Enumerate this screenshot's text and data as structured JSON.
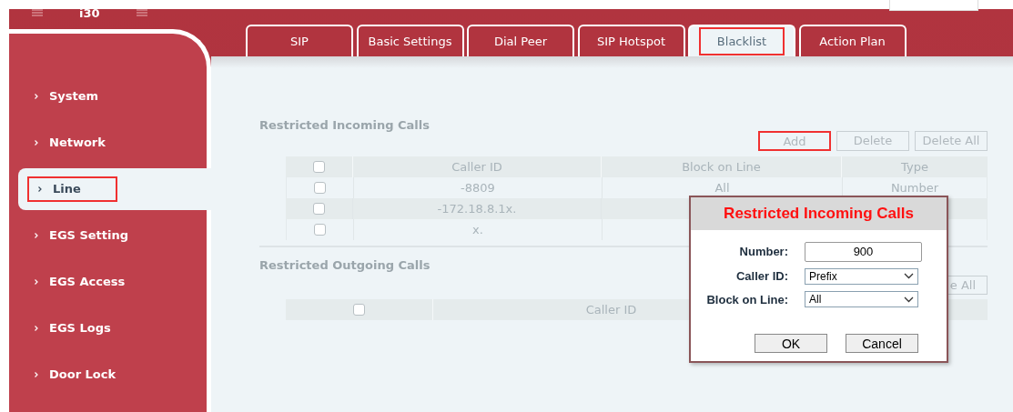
{
  "header": {
    "title": "i30"
  },
  "sidebar": {
    "items": [
      {
        "label": "System",
        "selected": false,
        "highlighted": false
      },
      {
        "label": "Network",
        "selected": false,
        "highlighted": false
      },
      {
        "label": "Line",
        "selected": true,
        "highlighted": true
      },
      {
        "label": "EGS Setting",
        "selected": false,
        "highlighted": false
      },
      {
        "label": "EGS Access",
        "selected": false,
        "highlighted": false
      },
      {
        "label": "EGS Logs",
        "selected": false,
        "highlighted": false
      },
      {
        "label": "Door Lock",
        "selected": false,
        "highlighted": false
      }
    ]
  },
  "tabs": [
    {
      "label": "SIP",
      "selected": false,
      "highlighted": false
    },
    {
      "label": "Basic Settings",
      "selected": false,
      "highlighted": false
    },
    {
      "label": "Dial Peer",
      "selected": false,
      "highlighted": false
    },
    {
      "label": "SIP Hotspot",
      "selected": false,
      "highlighted": false
    },
    {
      "label": "Blacklist",
      "selected": true,
      "highlighted": true
    },
    {
      "label": "Action Plan",
      "selected": false,
      "highlighted": false
    }
  ],
  "incoming": {
    "title": "Restricted Incoming Calls",
    "buttons": [
      {
        "label": "Add",
        "highlighted": true
      },
      {
        "label": "Delete",
        "highlighted": false
      },
      {
        "label": "Delete All",
        "highlighted": false
      }
    ],
    "table": {
      "header_checked": false,
      "columns": [
        "Caller ID",
        "Block on Line",
        "Type"
      ],
      "rows": [
        {
          "checked": false,
          "cells": [
            "-8809",
            "All",
            "Number"
          ]
        },
        {
          "checked": false,
          "cells": [
            "-172.18.8.1x."
          ]
        },
        {
          "checked": false,
          "cells": [
            "x."
          ]
        }
      ]
    }
  },
  "outgoing": {
    "title": "Restricted Outgoing Calls",
    "buttons": [
      {
        "label": "e All"
      }
    ],
    "table": {
      "header_checked": false,
      "columns": [
        "Caller ID"
      ]
    }
  },
  "dialog": {
    "title": "Restricted Incoming Calls",
    "fields": [
      {
        "kind": "input",
        "label": "Number:",
        "value": "900"
      },
      {
        "kind": "select",
        "label": "Caller ID:",
        "value": "Prefix"
      },
      {
        "kind": "select",
        "label": "Block on Line:",
        "value": "All"
      }
    ],
    "buttons": [
      "OK",
      "Cancel"
    ]
  }
}
